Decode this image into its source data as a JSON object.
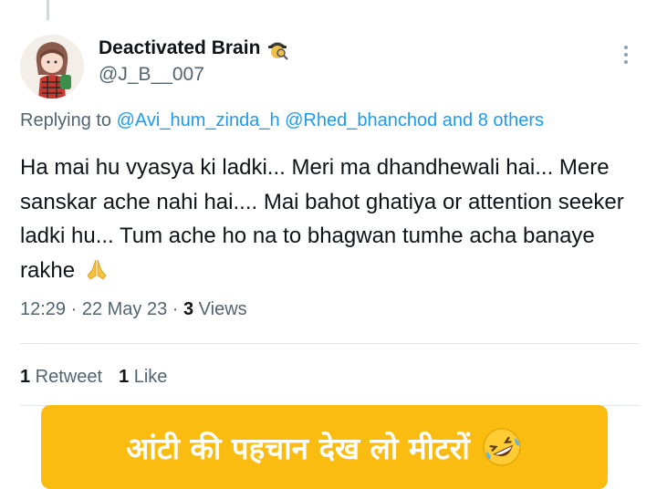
{
  "tweet": {
    "display_name": "Deactivated Brain",
    "name_emoji_icon": "detective-emoji",
    "handle": "@J_B__007",
    "replying_prefix": "Replying to",
    "replying_user_1": "@Avi_hum_zinda_h",
    "replying_user_2": "@Rhed_bhanchod",
    "replying_others": "and 8 others",
    "text": "Ha mai hu vyasya ki ladki... Meri ma dhandhewali hai... Mere sanskar ache nahi hai.... Mai bahot ghatiya or attention seeker ladki hu... Tum ache ho na to bhagwan tumhe acha banaye rakhe",
    "text_emoji_icon": "folded-hands-emoji",
    "time": "12:29 · 22 May 23 · ",
    "views_count": "3",
    "views_label": " Views",
    "retweet_count": "1",
    "retweet_label": " Retweet",
    "like_count": "1",
    "like_label": " Like"
  },
  "caption": {
    "text": "आंटी की पहचान देख लो मीटरों",
    "emoji_icon": "rolling-laughing-emoji",
    "background": "#fbbc12"
  },
  "colors": {
    "link": "#1d9bf0",
    "secondary_text": "#536471",
    "primary_text": "#0f1419"
  }
}
